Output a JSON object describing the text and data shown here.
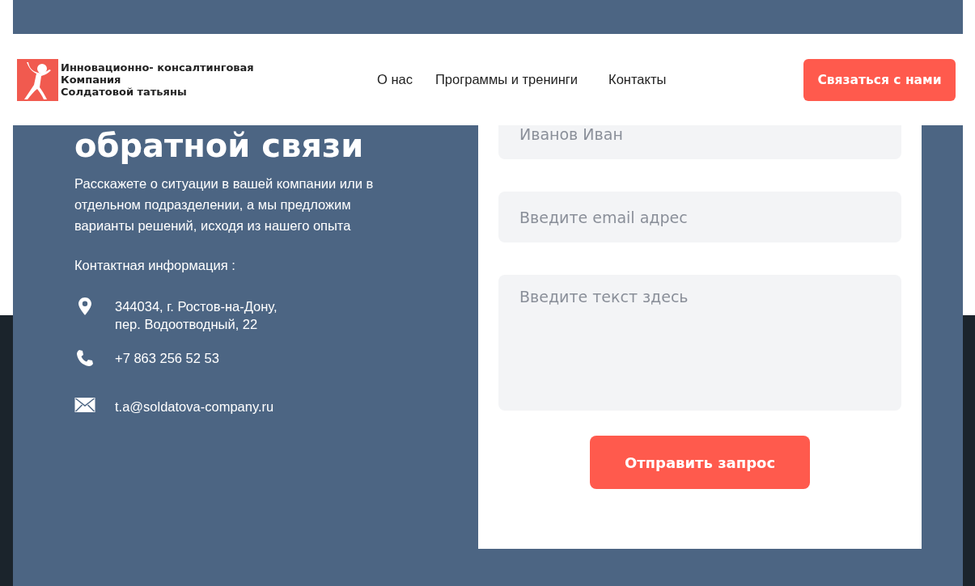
{
  "header": {
    "logo_text": [
      "Инновационно- консалтинговая",
      "Компания",
      "Солдатовой татьяны"
    ],
    "nav": [
      {
        "label": "О нас"
      },
      {
        "label": "Программы и тренинги"
      },
      {
        "label": "Контакты"
      }
    ],
    "cta": "Связаться с нами"
  },
  "intro": {
    "heading": "обратной связи",
    "description": "Расскажете о ситуации в вашей компании или в отдельном подразделении, а мы предложим варианты решений, исходя из нашего опыта",
    "contacts_title": "Контактная информация :",
    "contacts": [
      {
        "kind": "address",
        "lines": [
          "344034, г. Ростов-на-Дону,",
          "пер. Водоотводный, 22"
        ]
      },
      {
        "kind": "phone",
        "lines": [
          "+7 863 256 52 53"
        ]
      },
      {
        "kind": "email",
        "lines": [
          "t.a@soldatova-company.ru"
        ]
      }
    ]
  },
  "form": {
    "fields": [
      {
        "kind": "input",
        "placeholder": "Иванов Иван"
      },
      {
        "kind": "input",
        "placeholder": "Введите email адрес"
      },
      {
        "kind": "textarea",
        "placeholder": "Введите текст здесь"
      }
    ],
    "submit": "Отправить запрос"
  }
}
